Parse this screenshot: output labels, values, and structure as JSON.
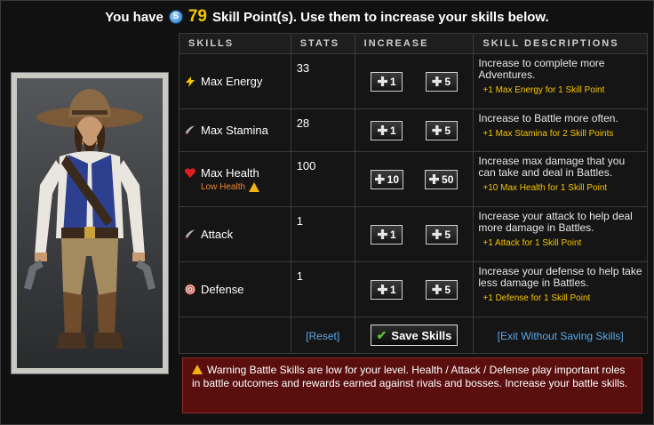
{
  "header": {
    "prefix": "You have",
    "coin_icon": "S",
    "points": "79",
    "suffix": "Skill Point(s). Use them to increase your skills below."
  },
  "table": {
    "columns": [
      "SKILLS",
      "STATS",
      "INCREASE",
      "SKILL DESCRIPTIONS"
    ],
    "rows": [
      {
        "name": "Max Energy",
        "icon": "lightning-icon",
        "stat": "33",
        "inc_small": "1",
        "inc_large": "5",
        "desc": "Increase to complete more Adventures.",
        "bonus": "+1 Max Energy for 1 Skill Point",
        "warning": ""
      },
      {
        "name": "Max Stamina",
        "icon": "sword-icon",
        "stat": "28",
        "inc_small": "1",
        "inc_large": "5",
        "desc": "Increase to Battle more often.",
        "bonus": "+1 Max Stamina for 2 Skill Points",
        "warning": ""
      },
      {
        "name": "Max Health",
        "icon": "heart-icon",
        "stat": "100",
        "inc_small": "10",
        "inc_large": "50",
        "desc": "Increase max damage that you can take and deal in Battles.",
        "bonus": "+10 Max Health for 1 Skill Point",
        "warning": "Low Health"
      },
      {
        "name": "Attack",
        "icon": "sword-icon",
        "stat": "1",
        "inc_small": "1",
        "inc_large": "5",
        "desc": "Increase your attack to help deal more damage in Battles.",
        "bonus": "+1 Attack for 1 Skill Point",
        "warning": ""
      },
      {
        "name": "Defense",
        "icon": "target-icon",
        "stat": "1",
        "inc_small": "1",
        "inc_large": "5",
        "desc": "Increase your defense to help take less damage in Battles.",
        "bonus": "+1 Defense for 1 Skill Point",
        "warning": ""
      }
    ]
  },
  "footer": {
    "reset": "[Reset]",
    "save": "Save Skills",
    "exit": "[Exit Without Saving Skills]"
  },
  "warning_box": {
    "text": "Warning Battle Skills are low for your level. Health / Attack / Defense play important roles in battle outcomes and rewards earned against rivals and bosses. Increase your battle skills."
  },
  "colors": {
    "accent_gold": "#f5c400",
    "link_blue": "#5aa7e6",
    "warning_bg": "#5a0f0e",
    "low_health_orange": "#e8842c"
  }
}
